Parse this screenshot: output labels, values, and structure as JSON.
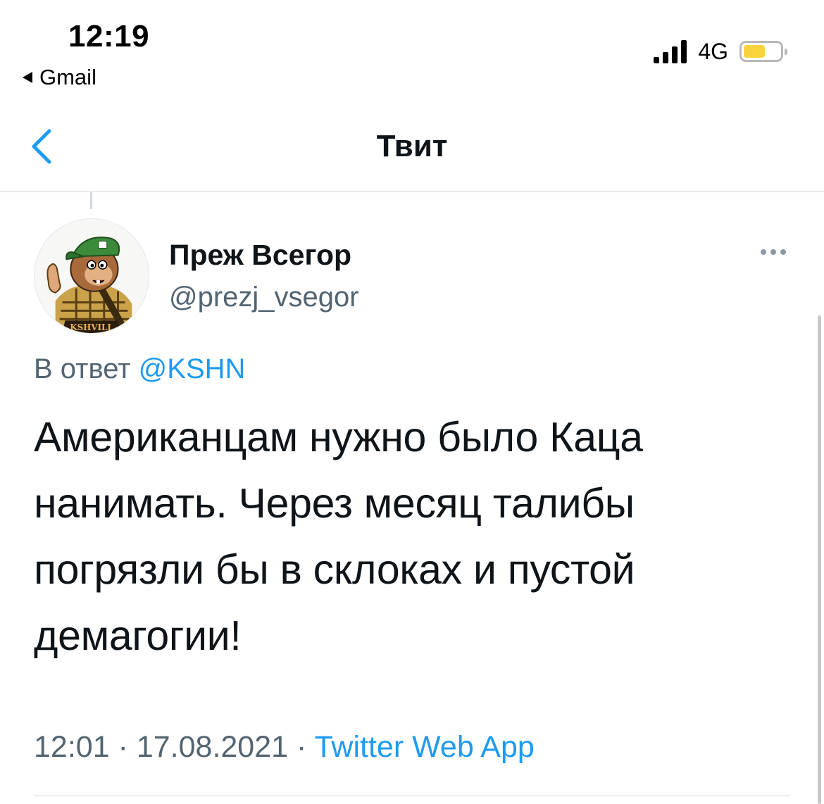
{
  "status_bar": {
    "time": "12:19",
    "back_app": "Gmail",
    "network": "4G",
    "battery_level": 0.6,
    "battery_color": "#f8d33c"
  },
  "nav": {
    "title": "Твит",
    "back_icon": "chevron-left-icon",
    "accent_color": "#1d9bf0"
  },
  "tweet": {
    "display_name": "Преж Всегор",
    "handle": "@prezj_vsegor",
    "avatar_text": "KSHVILL",
    "more_icon": "more-horizontal-icon",
    "reply_prefix": "В ответ",
    "reply_to": "@KSHN",
    "text": "Американцам нужно было Каца нанимать. Через месяц талибы погрязли бы в склоках и пустой демагогии!",
    "time": "12:01",
    "separator": "·",
    "date": "17.08.2021",
    "source": "Twitter Web App"
  }
}
